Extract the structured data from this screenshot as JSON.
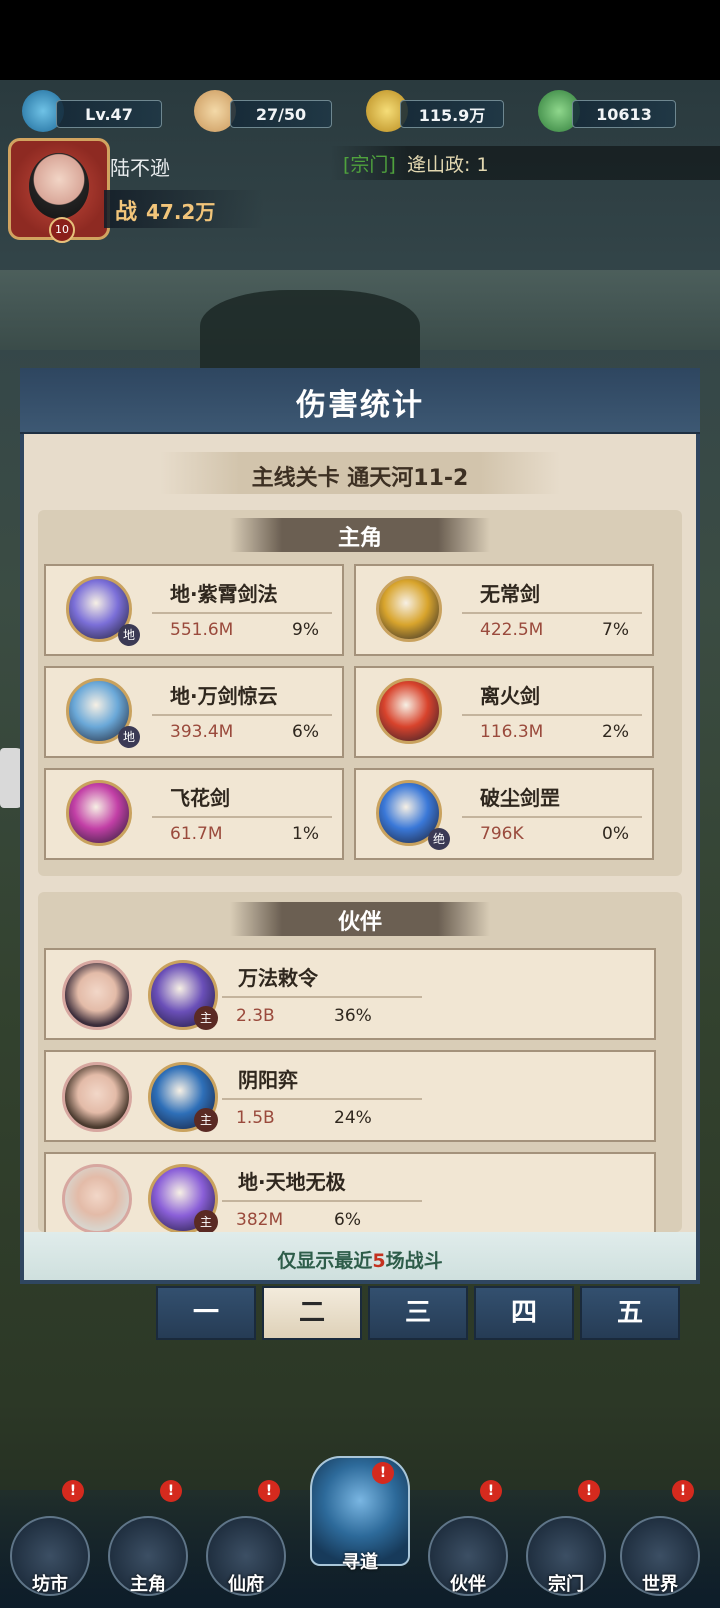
{
  "resources": {
    "level": "Lv.47",
    "stamina": "27/50",
    "coins": "115.9万",
    "jade": "10613"
  },
  "player": {
    "name": "陆不逊",
    "avatar_level": "10",
    "power_label": "战",
    "power_value": "47.2万"
  },
  "chat": {
    "tag": "[宗门]",
    "text": "逄山政: 1"
  },
  "panel": {
    "title": "伤害统计",
    "stage": "主线关卡 通天河11-2"
  },
  "protagonist": {
    "title": "主角",
    "skills": [
      {
        "name": "地·紫霄剑法",
        "damage": "551.6M",
        "percent": "9%",
        "badge": "地",
        "color": "#7b6fd8"
      },
      {
        "name": "无常剑",
        "damage": "422.5M",
        "percent": "7%",
        "badge": "",
        "color": "#d8a42c"
      },
      {
        "name": "地·万剑惊云",
        "damage": "393.4M",
        "percent": "6%",
        "badge": "地",
        "color": "#6aa8d8"
      },
      {
        "name": "离火剑",
        "damage": "116.3M",
        "percent": "2%",
        "badge": "",
        "color": "#d8432c"
      },
      {
        "name": "飞花剑",
        "damage": "61.7M",
        "percent": "1%",
        "badge": "",
        "color": "#c23fa6"
      },
      {
        "name": "破尘剑罡",
        "damage": "796K",
        "percent": "0%",
        "badge": "绝",
        "color": "#3a78d8"
      }
    ]
  },
  "partners": {
    "title": "伙伴",
    "items": [
      {
        "skill": "万法敕令",
        "damage": "2.3B",
        "percent": "36%",
        "badge": "主",
        "face": "#3a2c3a",
        "skill_color": "#6a4fb8"
      },
      {
        "skill": "阴阳弈",
        "damage": "1.5B",
        "percent": "24%",
        "badge": "主",
        "face": "#4a3a2e",
        "skill_color": "#2e6fb8"
      },
      {
        "skill": "地·天地无极",
        "damage": "382M",
        "percent": "6%",
        "badge": "主",
        "face": "#d9d4cc",
        "skill_color": "#8a5fd8"
      }
    ]
  },
  "footer": {
    "prefix": "仅显示最近",
    "count": "5",
    "suffix": "场战斗"
  },
  "tabs": [
    "一",
    "二",
    "三",
    "四",
    "五"
  ],
  "active_tab": 1,
  "nav": [
    {
      "label": "坊市",
      "alert": "!"
    },
    {
      "label": "主角",
      "alert": "!"
    },
    {
      "label": "仙府",
      "alert": "!"
    },
    {
      "label": "寻道",
      "alert": "!"
    },
    {
      "label": "伙伴",
      "alert": "!"
    },
    {
      "label": "宗门",
      "alert": "!"
    },
    {
      "label": "世界",
      "alert": "!"
    }
  ],
  "colors": {
    "panel_header": "#2e4660",
    "damage_text": "#9a4a3c",
    "alert_red": "#d52a1e"
  }
}
